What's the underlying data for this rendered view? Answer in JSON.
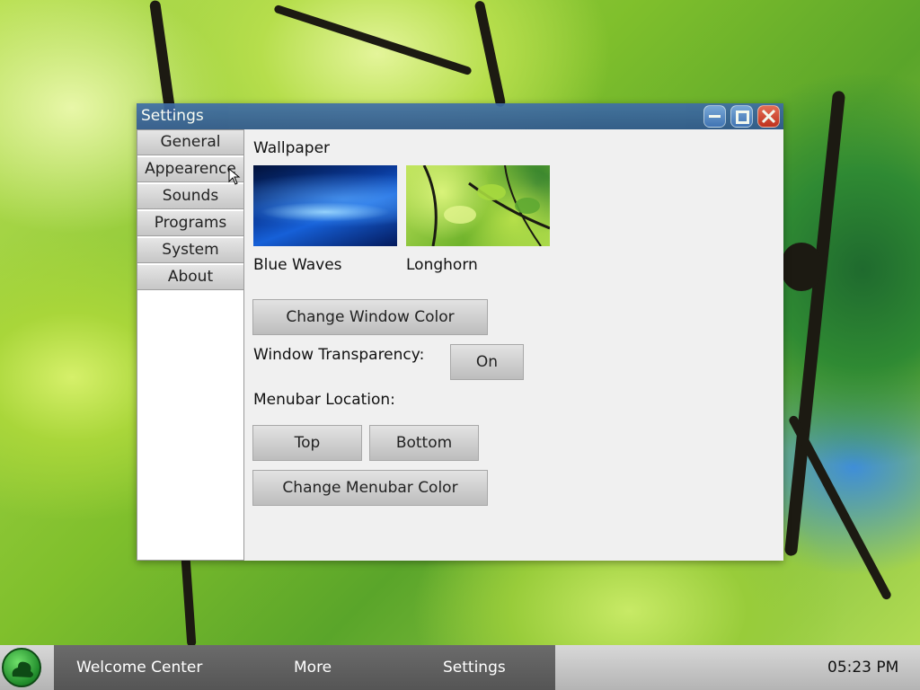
{
  "window": {
    "title": "Settings",
    "sidebar": {
      "items": [
        {
          "label": "General"
        },
        {
          "label": "Appearence"
        },
        {
          "label": "Sounds"
        },
        {
          "label": "Programs"
        },
        {
          "label": "System"
        },
        {
          "label": "About"
        }
      ],
      "selected": "Appearence"
    },
    "content": {
      "wallpaper_heading": "Wallpaper",
      "wallpapers": [
        {
          "name": "Blue Waves"
        },
        {
          "name": "Longhorn"
        }
      ],
      "change_window_color_label": "Change Window Color",
      "window_transparency_label": "Window Transparency:",
      "transparency_toggle_label": "On",
      "menubar_location_label": "Menubar Location:",
      "top_button_label": "Top",
      "bottom_button_label": "Bottom",
      "change_menubar_color_label": "Change Menubar Color"
    }
  },
  "taskbar": {
    "items": [
      {
        "label": "Welcome Center"
      },
      {
        "label": "More"
      },
      {
        "label": "Settings"
      }
    ],
    "clock": "05:23 PM"
  },
  "colors": {
    "titlebar": "#3f6ea6",
    "close_button": "#c8281c",
    "taskbar_strip": "#5f5f5f"
  }
}
